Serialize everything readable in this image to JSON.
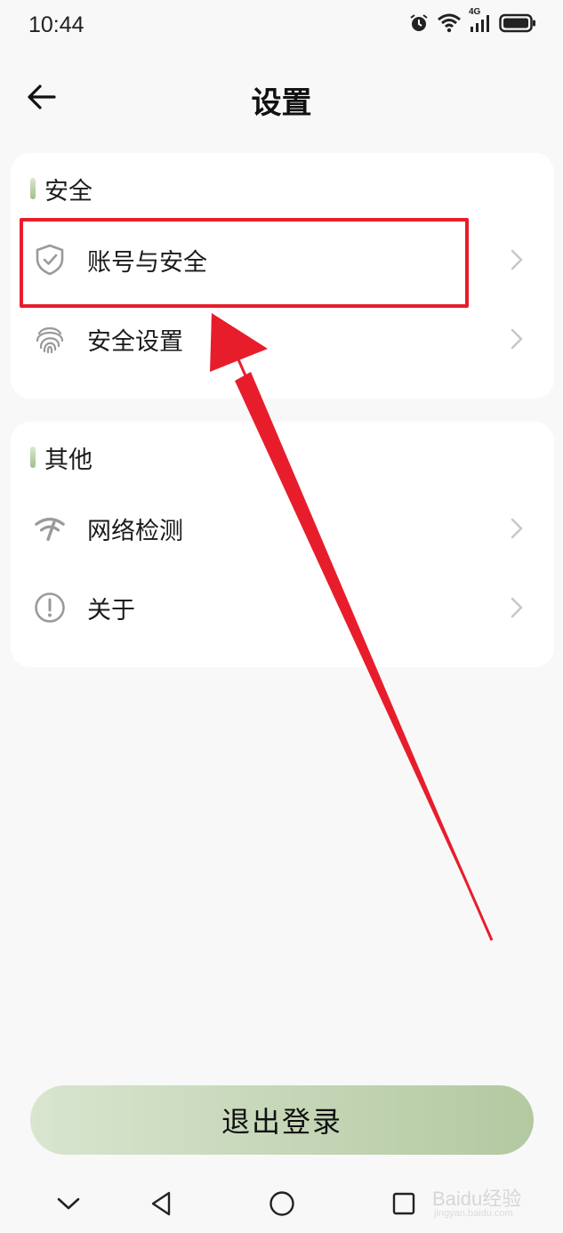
{
  "status_bar": {
    "time": "10:44",
    "network_label": "4G",
    "icons": [
      "alarm-icon",
      "wifi-icon",
      "signal-icon",
      "battery-icon"
    ]
  },
  "header": {
    "title": "设置",
    "back_icon": "arrow-left-icon"
  },
  "sections": [
    {
      "title": "安全",
      "items": [
        {
          "label": "账号与安全",
          "icon": "shield-check-icon",
          "highlighted": true
        },
        {
          "label": "安全设置",
          "icon": "fingerprint-icon",
          "highlighted": false
        }
      ]
    },
    {
      "title": "其他",
      "items": [
        {
          "label": "网络检测",
          "icon": "network-test-icon",
          "highlighted": false
        },
        {
          "label": "关于",
          "icon": "info-circle-icon",
          "highlighted": false
        }
      ]
    }
  ],
  "logout_label": "退出登录",
  "nav_bar": {
    "buttons": [
      "collapse-icon",
      "back-triangle-icon",
      "home-circle-icon",
      "recents-square-icon"
    ]
  },
  "watermark": {
    "text": "Baidu经验",
    "sub": "jingyan.baidu.com"
  },
  "colors": {
    "accent_gradient_start": "#d9e5cf",
    "accent_gradient_end": "#b3c9a1",
    "annotation_red": "#e81d2c",
    "background": "#f8f8f8"
  }
}
